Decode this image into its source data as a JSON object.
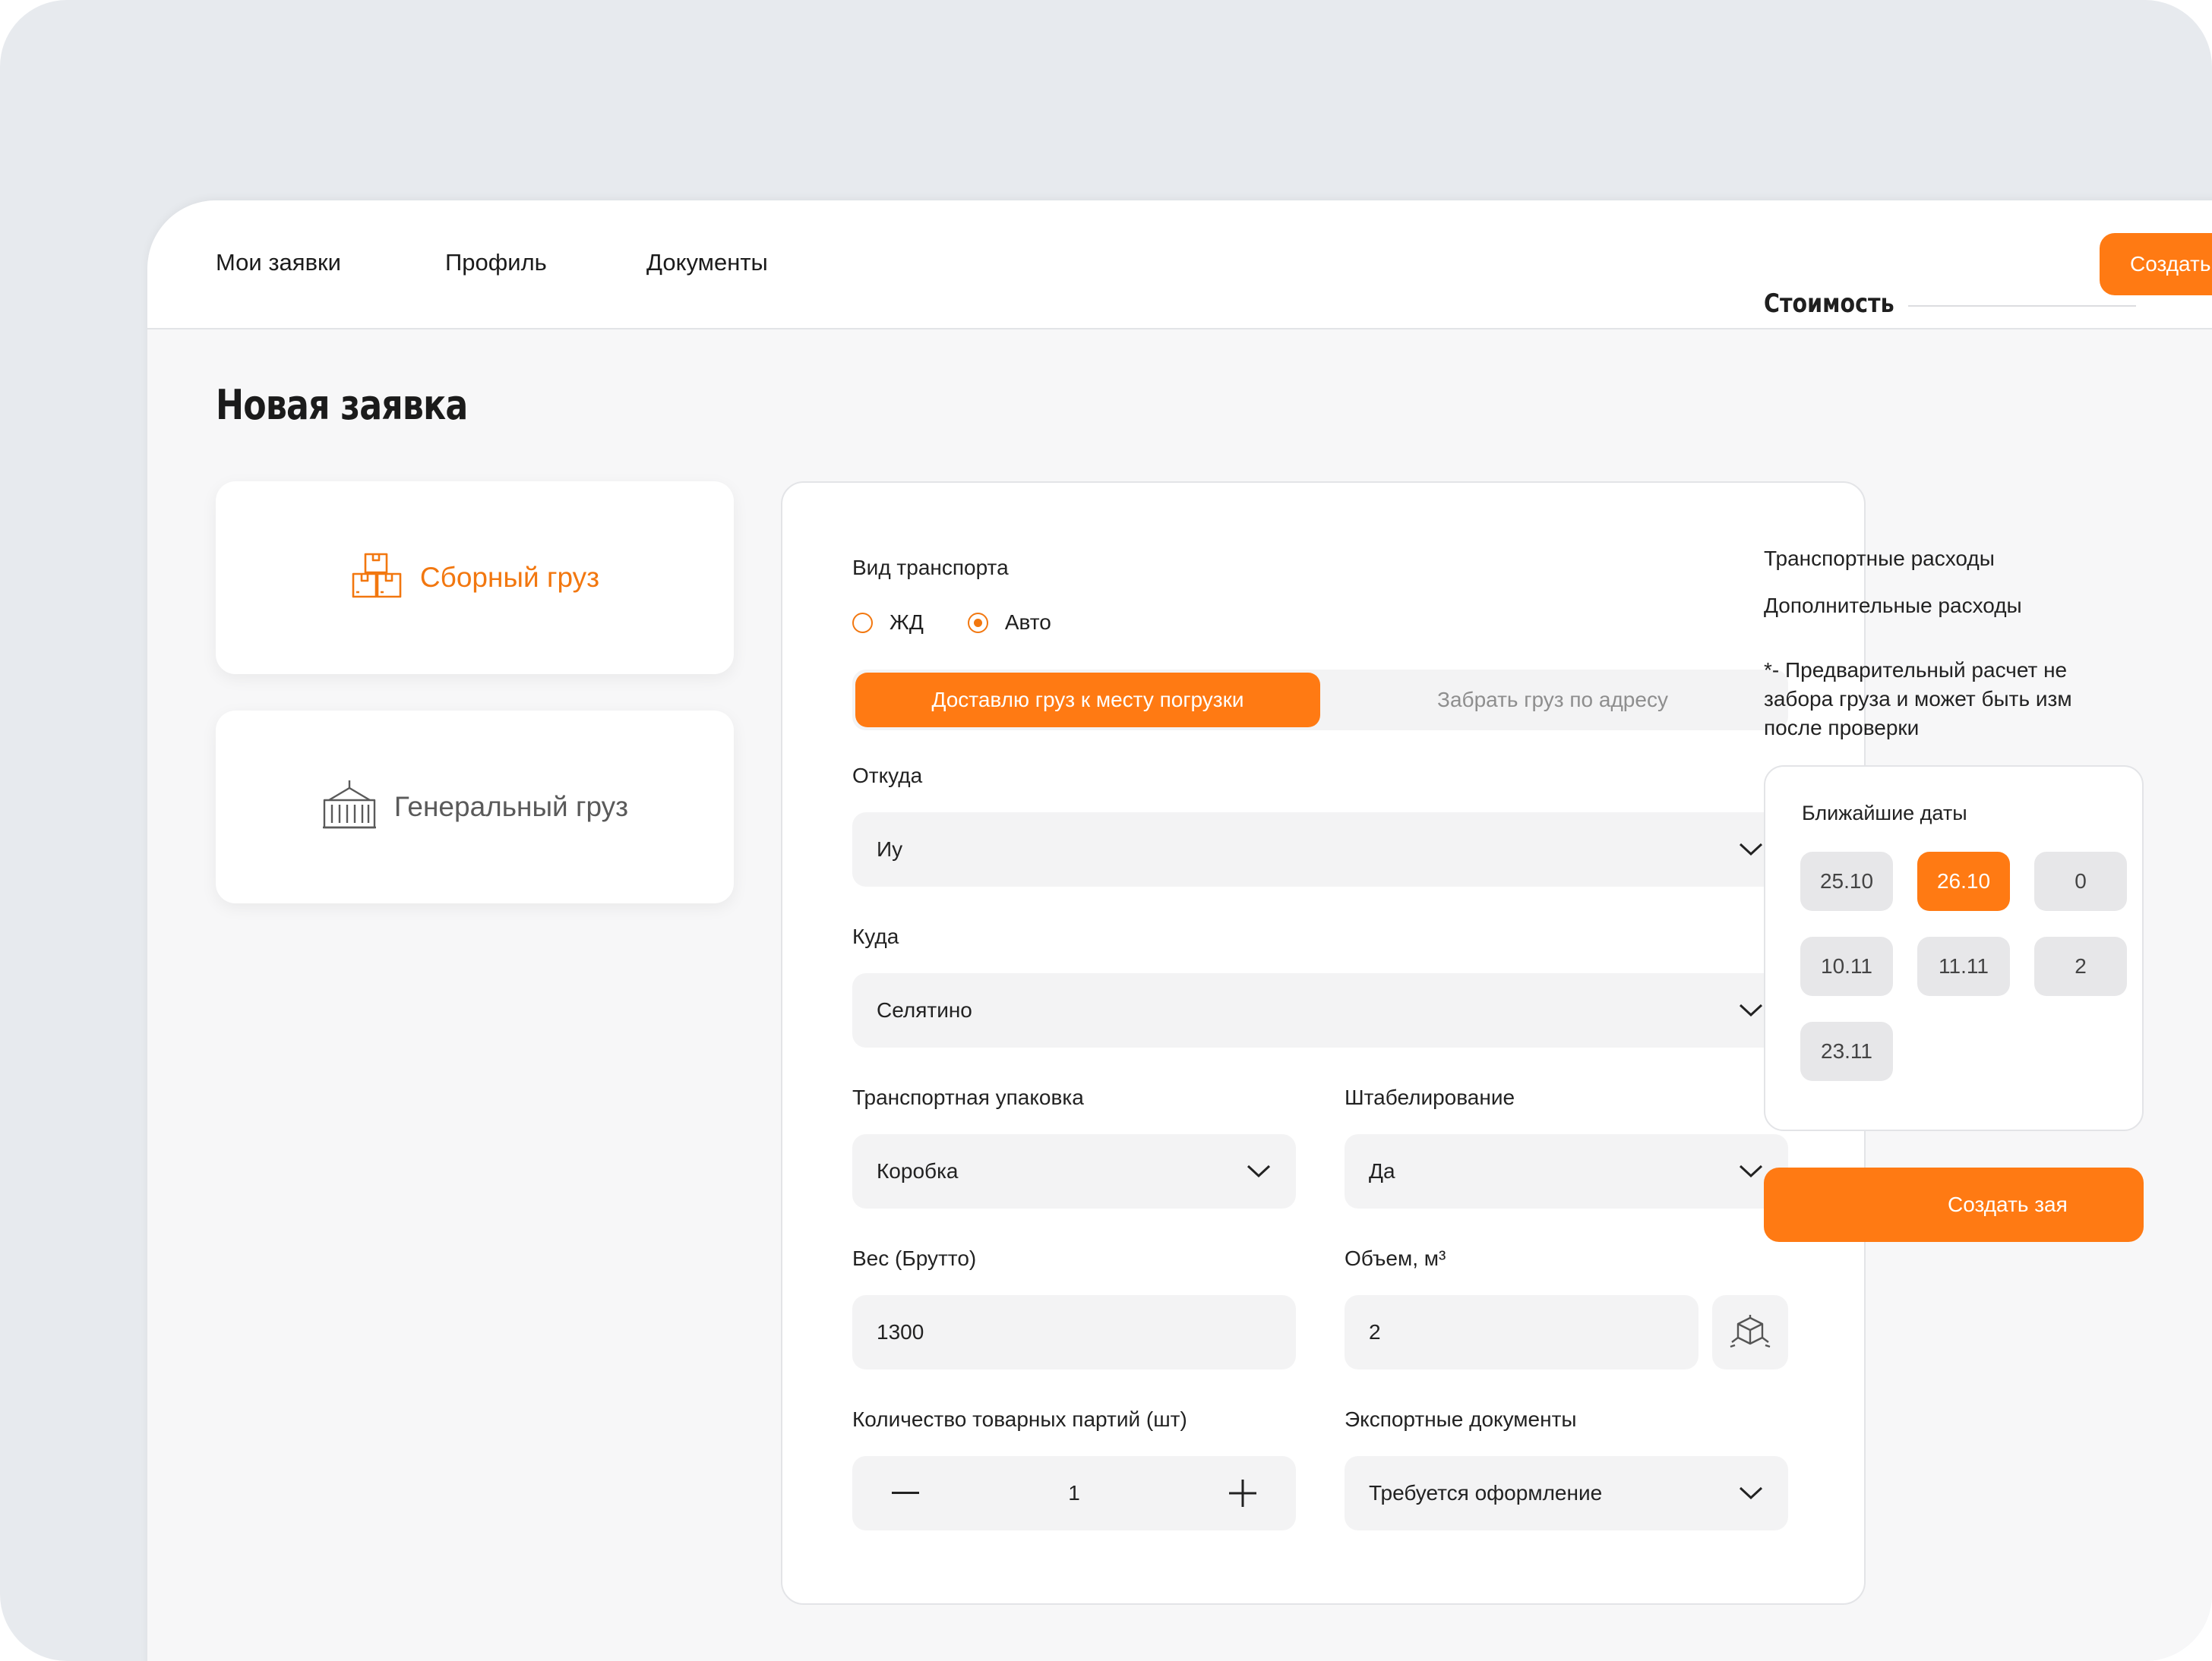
{
  "nav": {
    "items": [
      "Мои заявки",
      "Профиль",
      "Документы"
    ],
    "create_label": "Создать"
  },
  "page": {
    "title": "Новая заявка"
  },
  "cargo_types": [
    {
      "label": "Сборный груз",
      "icon": "boxes-icon",
      "active": true
    },
    {
      "label": "Генеральный груз",
      "icon": "container-crane-icon",
      "active": false
    }
  ],
  "form": {
    "transport_label": "Вид транспорта",
    "transport_options": [
      "ЖД",
      "Авто"
    ],
    "transport_selected": "Авто",
    "delivery_modes": [
      "Доставлю груз к месту погрузки",
      "Забрать груз по адресу"
    ],
    "delivery_selected": "Доставлю груз к месту погрузки",
    "from": {
      "label": "Откуда",
      "value": "Иу"
    },
    "to": {
      "label": "Куда",
      "value": "Селятино"
    },
    "packaging": {
      "label": "Транспортная упаковка",
      "value": "Коробка"
    },
    "stacking": {
      "label": "Штабелирование",
      "value": "Да"
    },
    "weight": {
      "label": "Вес (Брутто)",
      "value": "1300"
    },
    "volume": {
      "label": "Объем, м³",
      "value": "2"
    },
    "batches": {
      "label": "Количество товарных партий (шт)",
      "value": "1"
    },
    "export_docs": {
      "label": "Экспортные документы",
      "value": "Требуется оформление"
    }
  },
  "cost": {
    "title": "Стоимость",
    "transport_costs": "Транспортные расходы",
    "additional_costs": "Дополнительные расходы",
    "note_lines": [
      "*- Предварительный расчет не",
      "забора груза и может быть изм",
      "после проверки"
    ],
    "dates_label": "Ближайшие даты",
    "dates": [
      "25.10",
      "26.10",
      "0",
      "10.11",
      "11.11",
      "2",
      "23.11"
    ],
    "selected_date": "26.10",
    "create_label": "Создать зая"
  },
  "colors": {
    "accent": "#ff7a13",
    "accent_text": "#f2770f",
    "field_bg": "#f3f3f4"
  }
}
